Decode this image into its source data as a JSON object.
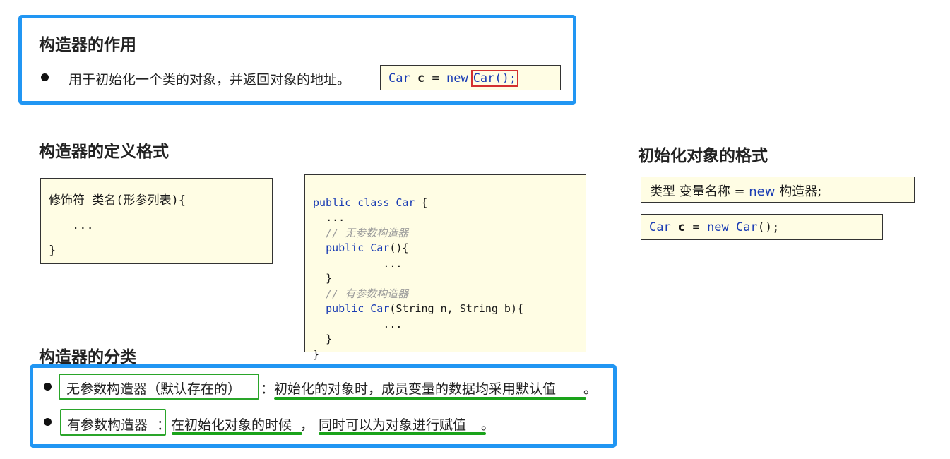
{
  "section1": {
    "title": "构造器的作用",
    "bullet_text": "用于初始化一个类的对象，并返回对象的地址。",
    "code": {
      "car": "Car",
      "var": "c",
      "eq": "=",
      "new_kw": "new",
      "ctor": "Car();"
    }
  },
  "section2": {
    "title": "构造器的定义格式",
    "format_lines": [
      "修饰符 类名(形参列表){",
      "...",
      "}"
    ],
    "example_code": {
      "line1_kw": "public class",
      "line1_cls": "Car",
      "line1_brace": "{",
      "line2": "...",
      "comment1": "// 无参数构造器",
      "line4_kw": "public",
      "line4_cls": "Car",
      "line4_rest": "(){",
      "line5": "...",
      "line6": "}",
      "comment2": "// 有参数构造器",
      "line8_kw": "public",
      "line8_cls": "Car",
      "line8_rest": "(String n, String b){",
      "line9": "...",
      "line10": "}",
      "line11": "}"
    }
  },
  "section3": {
    "title": "初始化对象的格式",
    "format": {
      "prefix": "类型 变量名称 = ",
      "new_kw": "new",
      "suffix": " 构造器;"
    },
    "example": {
      "car": "Car",
      "var": "c",
      "eq": "=",
      "new_kw": "new",
      "ctor": "Car",
      "end": "();"
    }
  },
  "section4": {
    "title": "构造器的分类",
    "items": [
      {
        "label": "无参数构造器（默认存在的）",
        "sep": "：",
        "desc": "初始化的对象时，成员变量的数据均采用默认值",
        "end": "。"
      },
      {
        "label": "有参数构造器",
        "sep": "：",
        "desc1": "在初始化对象的时候",
        "comma": "，",
        "desc2": "同时可以为对象进行赋值",
        "end": "。"
      }
    ]
  },
  "colors": {
    "blue_frame": "#2196f3",
    "code_bg": "#fffde4",
    "green": "#2aa52a",
    "red": "#d32f2f",
    "keyword": "#1a3cb4"
  }
}
